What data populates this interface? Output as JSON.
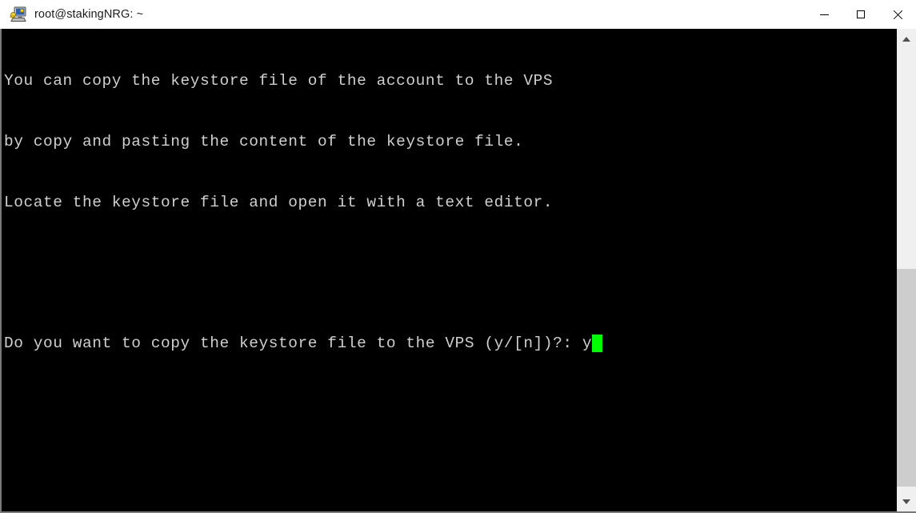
{
  "window": {
    "title": "root@stakingNRG: ~",
    "icon": "putty-terminal-icon",
    "controls": {
      "minimize_label": "Minimize",
      "maximize_label": "Maximize",
      "close_label": "Close"
    },
    "titlebar_bg": "#ffffff",
    "titlebar_fg": "#1c1c1c"
  },
  "terminal": {
    "background": "#000000",
    "foreground": "#cfcfcf",
    "cursor_color": "#00ff00",
    "lines": [
      "You can copy the keystore file of the account to the VPS",
      "by copy and pasting the content of the keystore file.",
      "Locate the keystore file and open it with a text editor.",
      "",
      ""
    ],
    "prompt": {
      "text": "Do you want to copy the keystore file to the VPS (y/[n])?: ",
      "typed_input": "y",
      "cursor": "block-cursor"
    }
  },
  "scrollbar": {
    "up_arrow": "chevron-up-icon",
    "down_arrow": "chevron-down-icon",
    "track_color": "#f0f0f0",
    "thumb_color": "#cdcdcd"
  }
}
